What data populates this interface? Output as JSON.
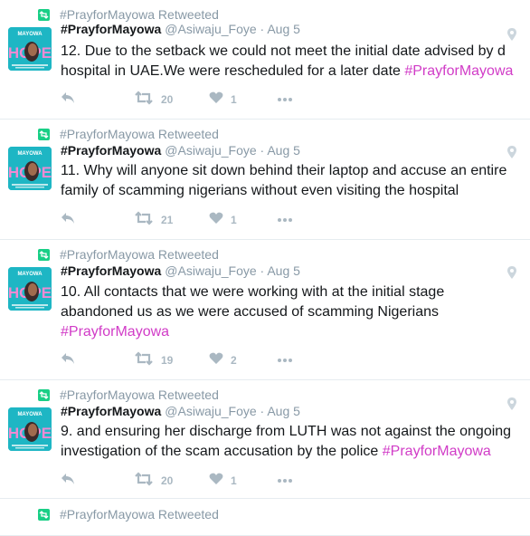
{
  "tweets": [
    {
      "retweeted_by": "#PrayforMayowa Retweeted",
      "name": "#PrayforMayowa",
      "handle_date": "@Asiwaju_Foye · Aug 5",
      "text_lines": [
        [
          "12. Due to the setback we could not meet the initial date advised by d"
        ],
        [
          "hospital in UAE.We were rescheduled for a later date ",
          "#PrayforMayowa"
        ]
      ],
      "retweets": "20",
      "likes": "1"
    },
    {
      "retweeted_by": "#PrayforMayowa Retweeted",
      "name": "#PrayforMayowa",
      "handle_date": "@Asiwaju_Foye · Aug 5",
      "text_lines": [
        [
          "11. Why will anyone sit down behind their laptop and accuse an entire"
        ],
        [
          "family of scamming nigerians without even visiting the hospital"
        ]
      ],
      "retweets": "21",
      "likes": "1"
    },
    {
      "retweeted_by": "#PrayforMayowa Retweeted",
      "name": "#PrayforMayowa",
      "handle_date": "@Asiwaju_Foye · Aug 5",
      "text_lines": [
        [
          "10. All contacts that we were working with at the initial stage"
        ],
        [
          "abandoned us as we were accused of scamming Nigerians"
        ],
        [
          "",
          "#PrayforMayowa"
        ]
      ],
      "retweets": "19",
      "likes": "2"
    },
    {
      "retweeted_by": "#PrayforMayowa Retweeted",
      "name": "#PrayforMayowa",
      "handle_date": "@Asiwaju_Foye · Aug 5",
      "text_lines": [
        [
          "9. and ensuring her discharge from LUTH was not against the ongoing"
        ],
        [
          "investigation of the scam accusation by the police ",
          "#PrayforMayowa"
        ]
      ],
      "retweets": "20",
      "likes": "1"
    },
    {
      "retweeted_by": "#PrayforMayowa Retweeted",
      "name": "",
      "handle_date": "",
      "text_lines": [],
      "retweets": "",
      "likes": ""
    }
  ],
  "avatar": {
    "top_text": "MAYOWA",
    "big_text": "HOPE",
    "bg_color": "#1eb6c4",
    "text_color": "#f08ad3"
  },
  "colors": {
    "hashtag": "#d13cc7",
    "retweet_icon": "#19cf86",
    "muted": "#8899a6",
    "action": "#aab8c2",
    "divider": "#e6ecf0"
  },
  "icons": {
    "retweet_context": "retweet-icon",
    "geo": "location-pin-icon",
    "reply": "reply-icon",
    "retweet": "retweet-icon",
    "like": "heart-icon",
    "more": "more-dots-icon"
  }
}
